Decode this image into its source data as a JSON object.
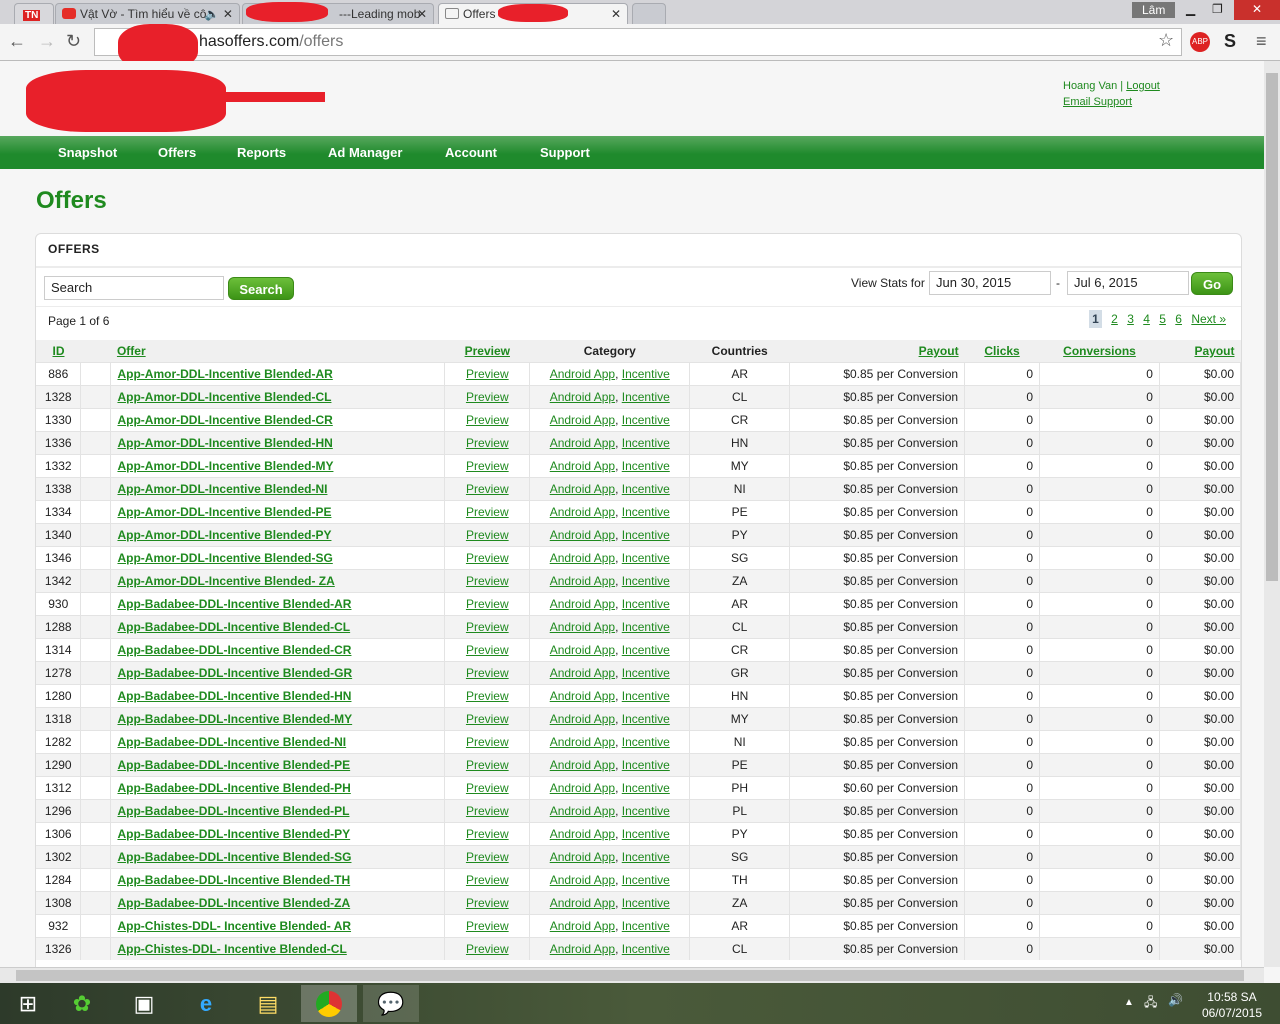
{
  "browser": {
    "tabs": [
      {
        "label": "TN"
      },
      {
        "label": "Vật Vờ - Tìm hiểu về cô"
      },
      {
        "label": "---Leading mob"
      },
      {
        "label": "Offers"
      }
    ],
    "user": "Lâm",
    "url_domain": "hasoffers.com",
    "url_path": "/offers"
  },
  "header": {
    "user_name": "Hoang Van",
    "separator": "|",
    "logout": "Logout",
    "email_support": "Email Support"
  },
  "nav": [
    "Snapshot",
    "Offers",
    "Reports",
    "Ad Manager",
    "Account",
    "Support"
  ],
  "page_title": "Offers",
  "panel": {
    "title": "OFFERS",
    "search_value": "Search",
    "search_button": "Search",
    "view_stats_label": "View Stats for",
    "date_from": "Jun 30, 2015",
    "date_sep": "-",
    "date_to": "Jul 6, 2015",
    "go_button": "Go",
    "page_info": "Page 1 of 6",
    "pages": [
      "1",
      "2",
      "3",
      "4",
      "5",
      "6"
    ],
    "next": "Next »"
  },
  "table": {
    "headers": [
      "ID",
      "",
      "Offer",
      "Preview",
      "Category",
      "Countries",
      "Payout",
      "Clicks",
      "Conversions",
      "Payout"
    ],
    "category": [
      "Android App",
      "Incentive"
    ],
    "preview": "Preview",
    "rows": [
      [
        "886",
        "App-Amor-DDL-Incentive Blended-AR",
        "AR",
        "$0.85 per Conversion",
        "0",
        "0",
        "$0.00"
      ],
      [
        "1328",
        "App-Amor-DDL-Incentive Blended-CL",
        "CL",
        "$0.85 per Conversion",
        "0",
        "0",
        "$0.00"
      ],
      [
        "1330",
        "App-Amor-DDL-Incentive Blended-CR",
        "CR",
        "$0.85 per Conversion",
        "0",
        "0",
        "$0.00"
      ],
      [
        "1336",
        "App-Amor-DDL-Incentive Blended-HN",
        "HN",
        "$0.85 per Conversion",
        "0",
        "0",
        "$0.00"
      ],
      [
        "1332",
        "App-Amor-DDL-Incentive Blended-MY",
        "MY",
        "$0.85 per Conversion",
        "0",
        "0",
        "$0.00"
      ],
      [
        "1338",
        "App-Amor-DDL-Incentive Blended-NI",
        "NI",
        "$0.85 per Conversion",
        "0",
        "0",
        "$0.00"
      ],
      [
        "1334",
        "App-Amor-DDL-Incentive Blended-PE",
        "PE",
        "$0.85 per Conversion",
        "0",
        "0",
        "$0.00"
      ],
      [
        "1340",
        "App-Amor-DDL-Incentive Blended-PY",
        "PY",
        "$0.85 per Conversion",
        "0",
        "0",
        "$0.00"
      ],
      [
        "1346",
        "App-Amor-DDL-Incentive Blended-SG",
        "SG",
        "$0.85 per Conversion",
        "0",
        "0",
        "$0.00"
      ],
      [
        "1342",
        "App-Amor-DDL-Incentive Blended- ZA",
        "ZA",
        "$0.85 per Conversion",
        "0",
        "0",
        "$0.00"
      ],
      [
        "930",
        "App-Badabee-DDL-Incentive Blended-AR",
        "AR",
        "$0.85 per Conversion",
        "0",
        "0",
        "$0.00"
      ],
      [
        "1288",
        "App-Badabee-DDL-Incentive Blended-CL",
        "CL",
        "$0.85 per Conversion",
        "0",
        "0",
        "$0.00"
      ],
      [
        "1314",
        "App-Badabee-DDL-Incentive Blended-CR",
        "CR",
        "$0.85 per Conversion",
        "0",
        "0",
        "$0.00"
      ],
      [
        "1278",
        "App-Badabee-DDL-Incentive Blended-GR",
        "GR",
        "$0.85 per Conversion",
        "0",
        "0",
        "$0.00"
      ],
      [
        "1280",
        "App-Badabee-DDL-Incentive Blended-HN",
        "HN",
        "$0.85 per Conversion",
        "0",
        "0",
        "$0.00"
      ],
      [
        "1318",
        "App-Badabee-DDL-Incentive Blended-MY",
        "MY",
        "$0.85 per Conversion",
        "0",
        "0",
        "$0.00"
      ],
      [
        "1282",
        "App-Badabee-DDL-Incentive Blended-NI",
        "NI",
        "$0.85 per Conversion",
        "0",
        "0",
        "$0.00"
      ],
      [
        "1290",
        "App-Badabee-DDL-Incentive Blended-PE",
        "PE",
        "$0.85 per Conversion",
        "0",
        "0",
        "$0.00"
      ],
      [
        "1312",
        "App-Badabee-DDL-Incentive Blended-PH",
        "PH",
        "$0.60 per Conversion",
        "0",
        "0",
        "$0.00"
      ],
      [
        "1296",
        "App-Badabee-DDL-Incentive Blended-PL",
        "PL",
        "$0.85 per Conversion",
        "0",
        "0",
        "$0.00"
      ],
      [
        "1306",
        "App-Badabee-DDL-Incentive Blended-PY",
        "PY",
        "$0.85 per Conversion",
        "0",
        "0",
        "$0.00"
      ],
      [
        "1302",
        "App-Badabee-DDL-Incentive Blended-SG",
        "SG",
        "$0.85 per Conversion",
        "0",
        "0",
        "$0.00"
      ],
      [
        "1284",
        "App-Badabee-DDL-Incentive Blended-TH",
        "TH",
        "$0.85 per Conversion",
        "0",
        "0",
        "$0.00"
      ],
      [
        "1308",
        "App-Badabee-DDL-Incentive Blended-ZA",
        "ZA",
        "$0.85 per Conversion",
        "0",
        "0",
        "$0.00"
      ],
      [
        "932",
        "App-Chistes-DDL- Incentive Blended- AR",
        "AR",
        "$0.85 per Conversion",
        "0",
        "0",
        "$0.00"
      ],
      [
        "1326",
        "App-Chistes-DDL- Incentive Blended-CL",
        "CL",
        "$0.85 per Conversion",
        "0",
        "0",
        "$0.00"
      ]
    ]
  },
  "taskbar": {
    "time": "10:58 SA",
    "date": "06/07/2015"
  }
}
